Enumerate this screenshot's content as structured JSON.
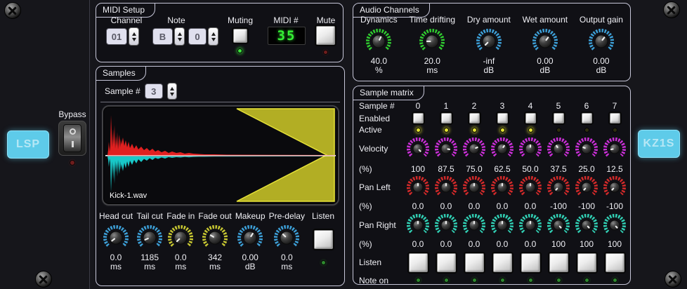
{
  "colors": {
    "green": "#30cc30",
    "blue": "#3da0d8",
    "magenta": "#cb2fd8",
    "red": "#d42a2a",
    "teal": "#31d1b5",
    "yellow": "#c8c832",
    "accent_logo": "#5ecbe9",
    "lcd_green": "#35f035"
  },
  "left_panel": {
    "logo": "LSP",
    "bypass_label": "Bypass"
  },
  "right_panel": {
    "logo": "KZ1S"
  },
  "midi_setup": {
    "title": "MIDI Setup",
    "channel_label": "Channel",
    "channel_value": "01",
    "note_label": "Note",
    "note_value": "B",
    "octave_value": "0",
    "muting_label": "Muting",
    "midi_number_label": "MIDI #",
    "midi_number_value": "35",
    "mute_label": "Mute"
  },
  "audio_channels": {
    "title": "Audio Channels",
    "knobs": [
      {
        "label": "Dynamics",
        "value": "40.0",
        "unit": "%",
        "color": "green",
        "pos": 0.6
      },
      {
        "label": "Time drifting",
        "value": "20.0",
        "unit": "ms",
        "color": "green",
        "pos": 0.17
      },
      {
        "label": "Dry amount",
        "value": "-inf",
        "unit": "dB",
        "color": "blue",
        "pos": 0.0
      },
      {
        "label": "Wet amount",
        "value": "0.00",
        "unit": "dB",
        "color": "blue",
        "pos": 0.64
      },
      {
        "label": "Output gain",
        "value": "0.00",
        "unit": "dB",
        "color": "blue",
        "pos": 0.64
      }
    ]
  },
  "samples": {
    "title": "Samples",
    "sample_number_label": "Sample #",
    "sample_number_value": "3",
    "file_name": "Kick-1.wav",
    "knobs": [
      {
        "label": "Head cut",
        "value": "0.0",
        "unit": "ms",
        "color": "blue",
        "pos": 0.03
      },
      {
        "label": "Tail cut",
        "value": "1185",
        "unit": "ms",
        "color": "blue",
        "pos": 0.08
      },
      {
        "label": "Fade in",
        "value": "0.0",
        "unit": "ms",
        "color": "yellow",
        "pos": 0.0
      },
      {
        "label": "Fade out",
        "value": "342",
        "unit": "ms",
        "color": "yellow",
        "pos": 0.28
      },
      {
        "label": "Makeup",
        "value": "0.00",
        "unit": "dB",
        "color": "blue",
        "pos": 0.62
      },
      {
        "label": "Pre-delay",
        "value": "0.0",
        "unit": "ms",
        "color": "blue",
        "pos": 0.33
      }
    ],
    "listen_label": "Listen"
  },
  "sample_matrix": {
    "title": "Sample matrix",
    "row_labels": {
      "sample_number": "Sample #",
      "enabled": "Enabled",
      "active": "Active",
      "velocity": "Velocity",
      "percent": "(%)",
      "pan_left": "Pan Left",
      "pan_right": "Pan Right",
      "listen": "Listen",
      "note_on": "Note on"
    },
    "columns": [
      {
        "index": "0",
        "active": true,
        "velocity": "100",
        "velocity_pos": 1.0,
        "pan_left": "0.0",
        "pan_left_pos": 0.5,
        "pan_right": "0.0",
        "pan_right_pos": 0.5
      },
      {
        "index": "1",
        "active": true,
        "velocity": "87.5",
        "velocity_pos": 0.875,
        "pan_left": "0.0",
        "pan_left_pos": 0.5,
        "pan_right": "0.0",
        "pan_right_pos": 0.5
      },
      {
        "index": "2",
        "active": true,
        "velocity": "75.0",
        "velocity_pos": 0.75,
        "pan_left": "0.0",
        "pan_left_pos": 0.5,
        "pan_right": "0.0",
        "pan_right_pos": 0.5
      },
      {
        "index": "3",
        "active": true,
        "velocity": "62.5",
        "velocity_pos": 0.625,
        "pan_left": "0.0",
        "pan_left_pos": 0.5,
        "pan_right": "0.0",
        "pan_right_pos": 0.5
      },
      {
        "index": "4",
        "active": true,
        "velocity": "50.0",
        "velocity_pos": 0.5,
        "pan_left": "0.0",
        "pan_left_pos": 0.5,
        "pan_right": "0.0",
        "pan_right_pos": 0.5
      },
      {
        "index": "5",
        "active": false,
        "velocity": "37.5",
        "velocity_pos": 0.375,
        "pan_left": "-100",
        "pan_left_pos": 0.0,
        "pan_right": "100",
        "pan_right_pos": 1.0
      },
      {
        "index": "6",
        "active": false,
        "velocity": "25.0",
        "velocity_pos": 0.25,
        "pan_left": "-100",
        "pan_left_pos": 0.0,
        "pan_right": "100",
        "pan_right_pos": 1.0
      },
      {
        "index": "7",
        "active": false,
        "velocity": "12.5",
        "velocity_pos": 0.125,
        "pan_left": "-100",
        "pan_left_pos": 0.0,
        "pan_right": "100",
        "pan_right_pos": 1.0
      }
    ]
  }
}
